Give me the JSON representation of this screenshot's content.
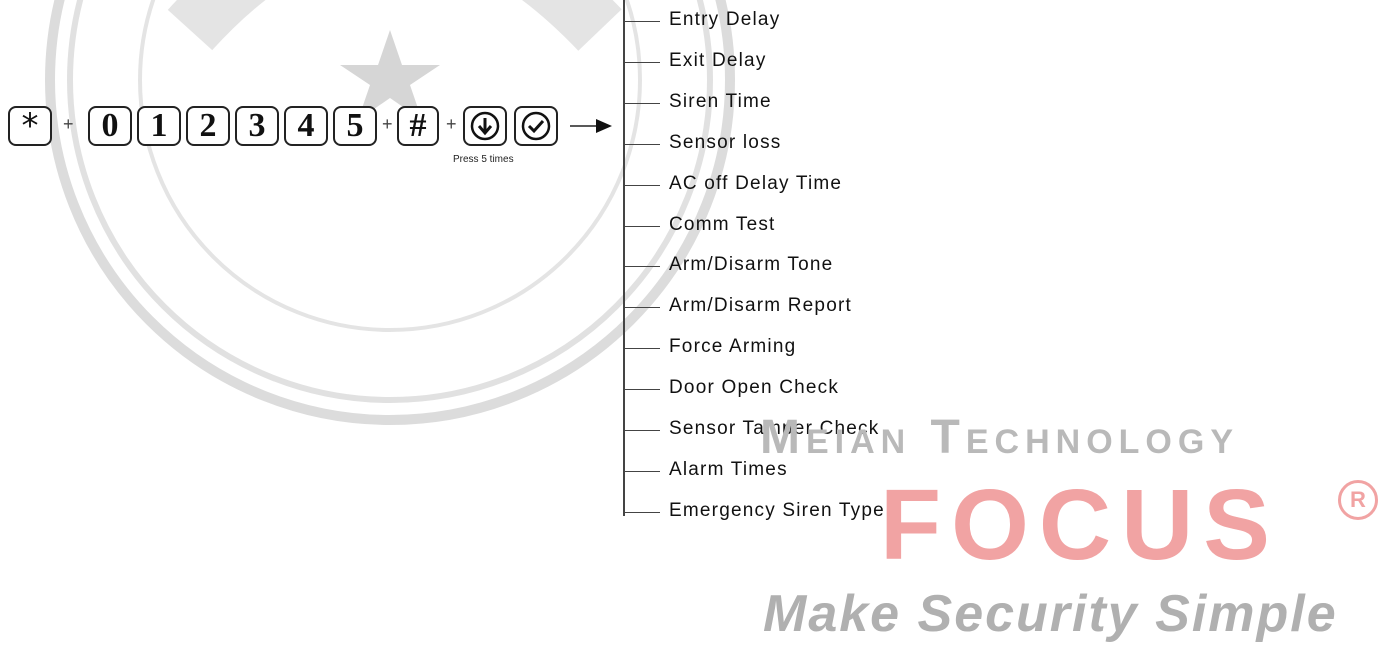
{
  "sequence": {
    "keys": [
      "*",
      "0",
      "1",
      "2",
      "3",
      "4",
      "5",
      "#"
    ],
    "separator": "+",
    "icons": [
      "down-arrow-icon",
      "confirm-check-icon"
    ],
    "note": "Press 5 times"
  },
  "menu_items": [
    "Entry Delay",
    "Exit Delay",
    "Siren Time",
    "Sensor loss",
    "AC off Delay Time",
    "Comm Test",
    "Arm/Disarm Tone",
    "Arm/Disarm Report",
    "Force Arming",
    "Door Open Check",
    "Sensor Tamper Check",
    "Alarm Times",
    "Emergency Siren Type"
  ],
  "branding": {
    "company": "Meian Technology",
    "brand": "FOCUS",
    "registered": "R",
    "slogan": "Make Security Simple"
  }
}
